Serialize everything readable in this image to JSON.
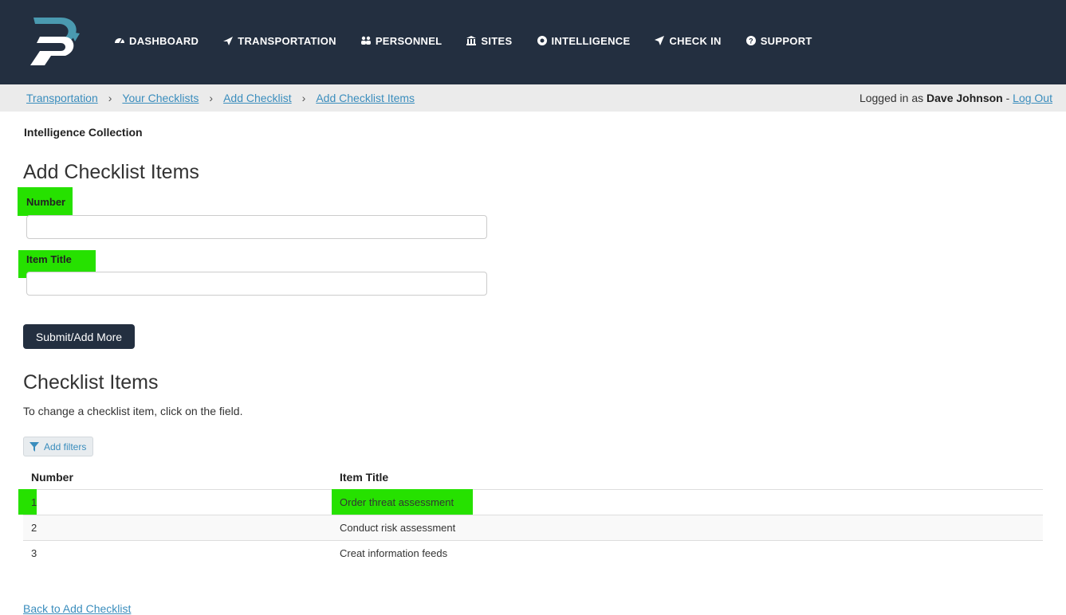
{
  "nav": {
    "logo_name": "brand-logo",
    "items": [
      {
        "label": "DASHBOARD",
        "icon": "dashboard-icon"
      },
      {
        "label": "TRANSPORTATION",
        "icon": "plane-icon"
      },
      {
        "label": "PERSONNEL",
        "icon": "users-icon"
      },
      {
        "label": "SITES",
        "icon": "building-icon"
      },
      {
        "label": "INTELLIGENCE",
        "icon": "compass-icon"
      },
      {
        "label": "CHECK IN",
        "icon": "location-arrow-icon"
      },
      {
        "label": "SUPPORT",
        "icon": "question-icon"
      }
    ]
  },
  "breadcrumb": [
    "Transportation",
    "Your Checklists",
    "Add Checklist",
    "Add Checklist Items"
  ],
  "login": {
    "prefix": "Logged in as",
    "user": "Dave Johnson",
    "separator": "-",
    "logout": "Log Out"
  },
  "subtitle": "Intelligence Collection",
  "form": {
    "title": "Add Checklist Items",
    "number_label": "Number",
    "number_value": "",
    "item_title_label": "Item Title",
    "item_title_value": "",
    "submit_label": "Submit/Add More"
  },
  "list": {
    "title": "Checklist Items",
    "help": "To change a checklist item, click on the field.",
    "filter_label": "Add filters",
    "columns": [
      "Number",
      "Item Title"
    ],
    "rows": [
      {
        "number": "1",
        "title": "Order threat assessment"
      },
      {
        "number": "2",
        "title": "Conduct risk assessment"
      },
      {
        "number": "3",
        "title": "Creat information feeds"
      }
    ]
  },
  "back_link": "Back to Add Checklist",
  "colors": {
    "navbar": "#232f40",
    "link": "#3a8dbd",
    "highlight": "#26e100",
    "logo": "#4a9ab0"
  }
}
